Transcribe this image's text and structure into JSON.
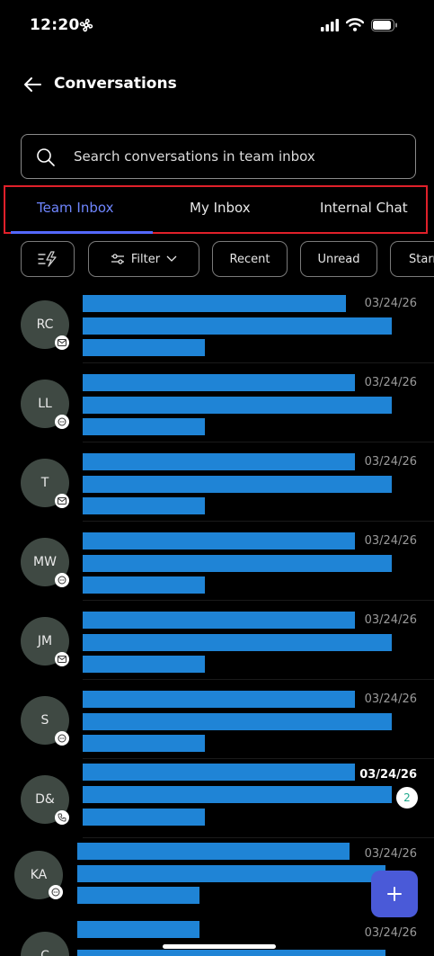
{
  "status_bar": {
    "time": "12:20",
    "left_icon": "fan-icon",
    "right_icons": [
      "signal-icon",
      "wifi-icon",
      "battery-icon"
    ]
  },
  "header": {
    "back_icon": "back-arrow-icon",
    "title": "Conversations"
  },
  "search": {
    "icon": "search-icon",
    "placeholder": "Search conversations in team inbox"
  },
  "tabs": [
    {
      "label": "Team Inbox",
      "active": true
    },
    {
      "label": "My Inbox",
      "active": false
    },
    {
      "label": "Internal Chat",
      "active": false
    }
  ],
  "filters": {
    "quick_action_icon": "lightning-filter-icon",
    "filter_label": "Filter",
    "filter_icon": "sliders-icon",
    "chevron_icon": "chevron-down-icon",
    "chips": [
      "Recent",
      "Unread",
      "Starr"
    ]
  },
  "conversations": [
    {
      "initials": "RC",
      "date": "03/24/26",
      "channel_icon": "email-icon",
      "unread_count": null
    },
    {
      "initials": "LL",
      "date": "03/24/26",
      "channel_icon": "chat-icon",
      "unread_count": null
    },
    {
      "initials": "T",
      "date": "03/24/26",
      "channel_icon": "email-icon",
      "unread_count": null
    },
    {
      "initials": "MW",
      "date": "03/24/26",
      "channel_icon": "chat-icon",
      "unread_count": null
    },
    {
      "initials": "JM",
      "date": "03/24/26",
      "channel_icon": "email-icon",
      "unread_count": null
    },
    {
      "initials": "S",
      "date": "03/24/26",
      "channel_icon": "chat-icon",
      "unread_count": null
    },
    {
      "initials": "D&",
      "date": "03/24/26",
      "channel_icon": "phone-icon",
      "unread_count": "2"
    },
    {
      "initials": "KA",
      "date": "03/24/26",
      "channel_icon": "chat-icon",
      "unread_count": null
    },
    {
      "initials": "C",
      "date": "03/24/26",
      "channel_icon": "chat-icon",
      "unread_count": null
    }
  ],
  "fab": {
    "icon": "plus-icon",
    "label": "+"
  },
  "colors": {
    "background": "#000000",
    "accent": "#5468ff",
    "redacted_bar": "#1f84d6",
    "fab": "#4a5ad8",
    "highlight_border": "#e0202a",
    "avatar": "#3f4943"
  }
}
